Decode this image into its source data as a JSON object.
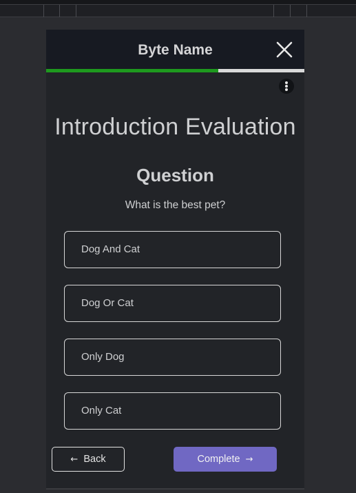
{
  "modal": {
    "title": "Byte Name",
    "progress_fraction": 0.667,
    "heading": "Introduction Evaluation",
    "subheading": "Question",
    "question": "What is the best pet?",
    "options": [
      {
        "label": "Dog And Cat"
      },
      {
        "label": "Dog Or Cat"
      },
      {
        "label": "Only Dog"
      },
      {
        "label": "Only Cat"
      }
    ],
    "back_arrow": "←",
    "back_label": "Back",
    "complete_label": "Complete",
    "complete_arrow": "→",
    "icons": {
      "close": "close-icon",
      "menu": "more-vertical-icon"
    }
  },
  "colors": {
    "header_bg": "#171a22",
    "body_bg": "#222428",
    "progress": "#1e9a1e",
    "progress_track": "#d9d9d9",
    "accent": "#7068c3"
  }
}
